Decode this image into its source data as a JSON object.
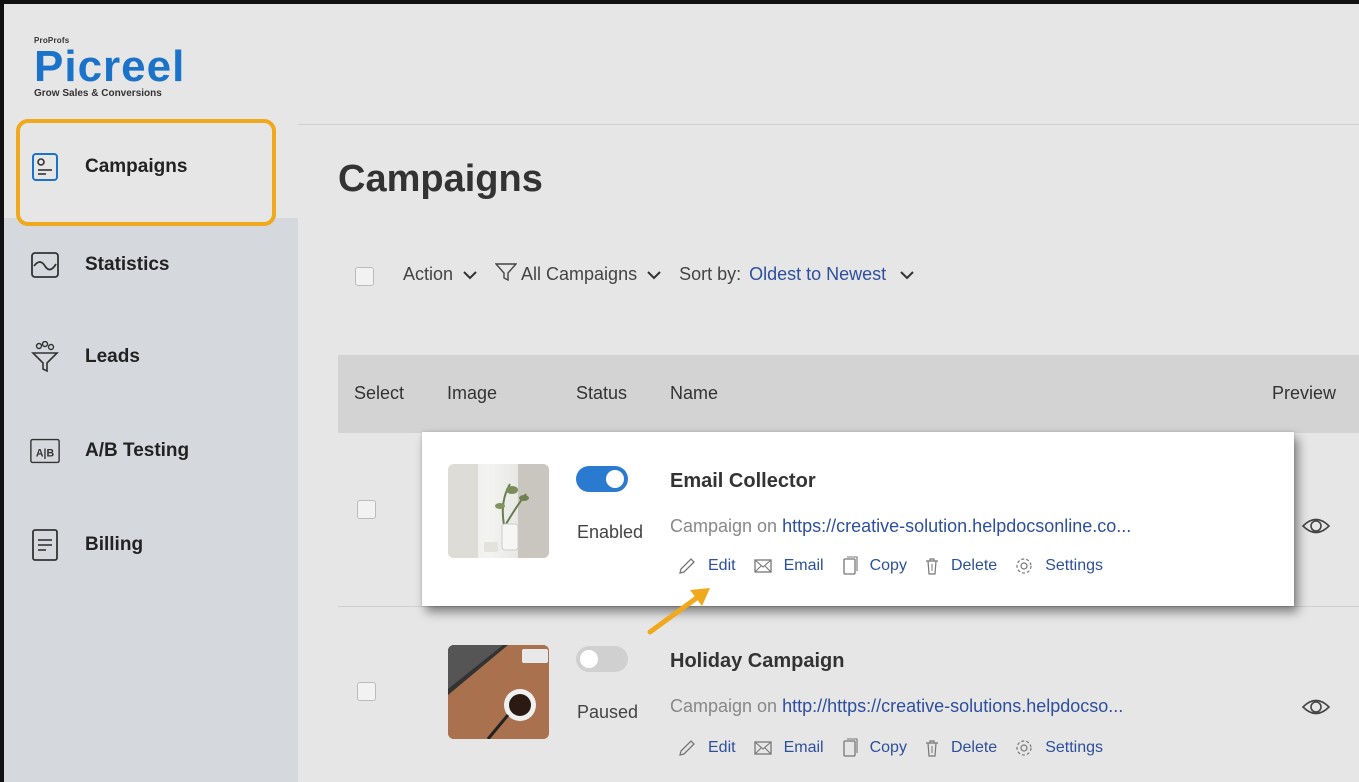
{
  "brand": {
    "company": "ProProfs",
    "product": "Picreel",
    "tagline": "Grow Sales & Conversions"
  },
  "sidebar": {
    "items": [
      {
        "label": "Campaigns",
        "icon": "campaign-icon",
        "active": true
      },
      {
        "label": "Statistics",
        "icon": "statistics-icon"
      },
      {
        "label": "Leads",
        "icon": "funnel-icon"
      },
      {
        "label": "A/B Testing",
        "icon": "ab-testing-icon"
      },
      {
        "label": "Billing",
        "icon": "billing-icon"
      }
    ]
  },
  "main": {
    "title": "Campaigns",
    "toolbar": {
      "action_label": "Action",
      "filter_label": "All Campaigns",
      "sort_prefix": "Sort by:",
      "sort_value": "Oldest to Newest"
    },
    "table": {
      "headers": [
        "Select",
        "Image",
        "Status",
        "Name",
        "Preview"
      ],
      "rows": [
        {
          "status": "Enabled",
          "enabled": true,
          "name": "Email Collector",
          "line_prefix": "Campaign on",
          "url": "https://creative-solution.helpdocsonline.co..."
        },
        {
          "status": "Paused",
          "enabled": false,
          "name": "Holiday Campaign",
          "line_prefix": "Campaign on",
          "url": "http://https://creative-solutions.helpdocso..."
        }
      ],
      "actions": [
        "Edit",
        "Email",
        "Copy",
        "Delete",
        "Settings"
      ]
    }
  },
  "colors": {
    "brand_blue": "#1a73c8",
    "link_blue": "#2d4f9c",
    "highlight_orange": "#f0a81c",
    "toggle_on": "#2a7bd0",
    "toggle_off": "#d0d0d0"
  }
}
